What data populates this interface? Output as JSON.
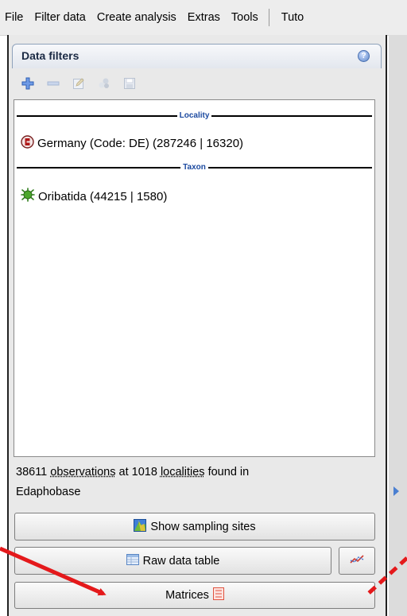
{
  "menu": {
    "items": [
      "File",
      "Filter data",
      "Create analysis",
      "Extras",
      "Tools",
      "Tuto"
    ]
  },
  "panel": {
    "title": "Data filters",
    "help_icon": "help-icon",
    "toolbar_icons": [
      "add-icon",
      "remove-icon",
      "edit-icon",
      "copy-icon",
      "save-icon"
    ]
  },
  "filters": {
    "locality_header": "Locality",
    "locality_item": "Germany (Code: DE) (287246 | 16320)",
    "locality_icon": "locality-pin-icon",
    "taxon_header": "Taxon",
    "taxon_item": "Oribatida (44215 | 1580)",
    "taxon_icon": "mite-icon"
  },
  "status": {
    "count_obs": "38611",
    "obs_word": "observations",
    "at": "at",
    "count_loc": "1018",
    "loc_word": "localities",
    "tail": "found in",
    "source": "Edaphobase"
  },
  "buttons": {
    "sampling_sites": "Show sampling sites",
    "raw_data": "Raw data table",
    "matrices": "Matrices"
  },
  "colors": {
    "accent_blue": "#1c4aa0",
    "arrow_red": "#e4191b",
    "panel_bg": "#e9e9e9"
  }
}
